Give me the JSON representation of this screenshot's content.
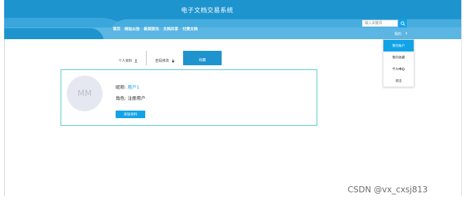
{
  "header": {
    "title": "电子文档交易系统",
    "nav": [
      "首页",
      "网站公告",
      "新闻资讯",
      "文档共享",
      "付费文档"
    ],
    "search": {
      "placeholder": "输入关键词"
    },
    "user_menu": "我的"
  },
  "dropdown": {
    "items": [
      "我的账户",
      "我的收藏",
      "个人中心",
      "退出"
    ]
  },
  "tabs": [
    {
      "label": "个人资料",
      "icon": "user-icon"
    },
    {
      "label": "密码修改",
      "icon": "lock-icon"
    },
    {
      "label": "收藏",
      "active": true
    }
  ],
  "profile": {
    "avatar_text": "MM",
    "nickname_label": "昵称:",
    "nickname_value": "用户1",
    "role_label": "角色:",
    "role_value": "注册用户",
    "add_button": "添加资料"
  },
  "watermark": "CSDN @vx_cxsj813",
  "colors": {
    "header_bg": "#1e94cf",
    "accent": "#11a3e8",
    "card_border": "#51c7c7"
  }
}
